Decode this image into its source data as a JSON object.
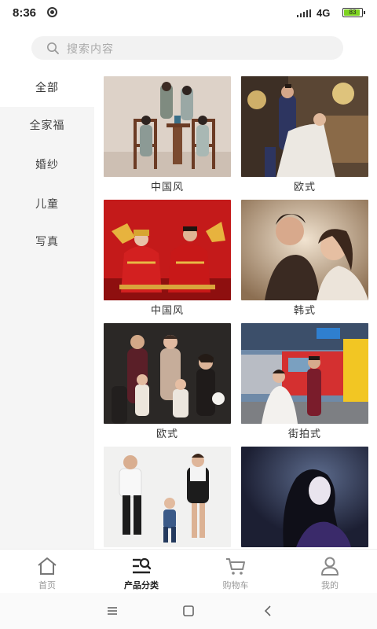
{
  "status": {
    "time": "8:36",
    "network": "4G",
    "battery": "83",
    "battery_fraction": 0.83
  },
  "search": {
    "placeholder": "搜索内容",
    "icon": "search-icon"
  },
  "sidebar": {
    "items": [
      {
        "label": "全部",
        "active": true
      },
      {
        "label": "全家福",
        "active": false
      },
      {
        "label": "婚纱",
        "active": false
      },
      {
        "label": "儿童",
        "active": false
      },
      {
        "label": "写真",
        "active": false
      }
    ]
  },
  "grid": {
    "items": [
      {
        "caption": "中国风",
        "photo": "family-chinese-style-photo"
      },
      {
        "caption": "欧式",
        "photo": "wedding-european-style-photo"
      },
      {
        "caption": "中国风",
        "photo": "red-chinese-wedding-photo"
      },
      {
        "caption": "韩式",
        "photo": "couple-korean-style-photo"
      },
      {
        "caption": "欧式",
        "photo": "family-european-style-photo"
      },
      {
        "caption": "街拍式",
        "photo": "street-wedding-photo"
      },
      {
        "caption": "",
        "photo": "family-casual-photo"
      },
      {
        "caption": "",
        "photo": "portrait-dark-photo"
      }
    ]
  },
  "tabbar": {
    "items": [
      {
        "label": "首页",
        "icon": "home-icon",
        "active": false
      },
      {
        "label": "产品分类",
        "icon": "category-search-icon",
        "active": true
      },
      {
        "label": "购物车",
        "icon": "cart-icon",
        "active": false
      },
      {
        "label": "我的",
        "icon": "user-icon",
        "active": false
      }
    ]
  },
  "colors": {
    "sidebar_bg": "#f5f5f5",
    "active_text": "#222222",
    "inactive_text": "#999999"
  }
}
